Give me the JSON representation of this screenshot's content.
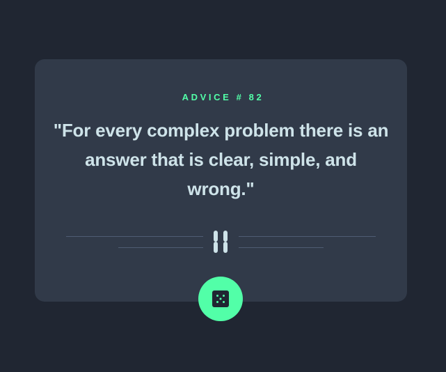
{
  "card": {
    "advice_label": "ADVICE # 82",
    "quote": "\"For every complex problem there is an answer that is clear, simple, and wrong.\""
  },
  "icons": {
    "divider": "pause-divider-icon",
    "dice": "dice-icon"
  },
  "colors": {
    "background": "#202632",
    "card": "#313a49",
    "accent": "#52ffa8",
    "text": "#cee3e9",
    "divider_line": "#4f5d74"
  }
}
